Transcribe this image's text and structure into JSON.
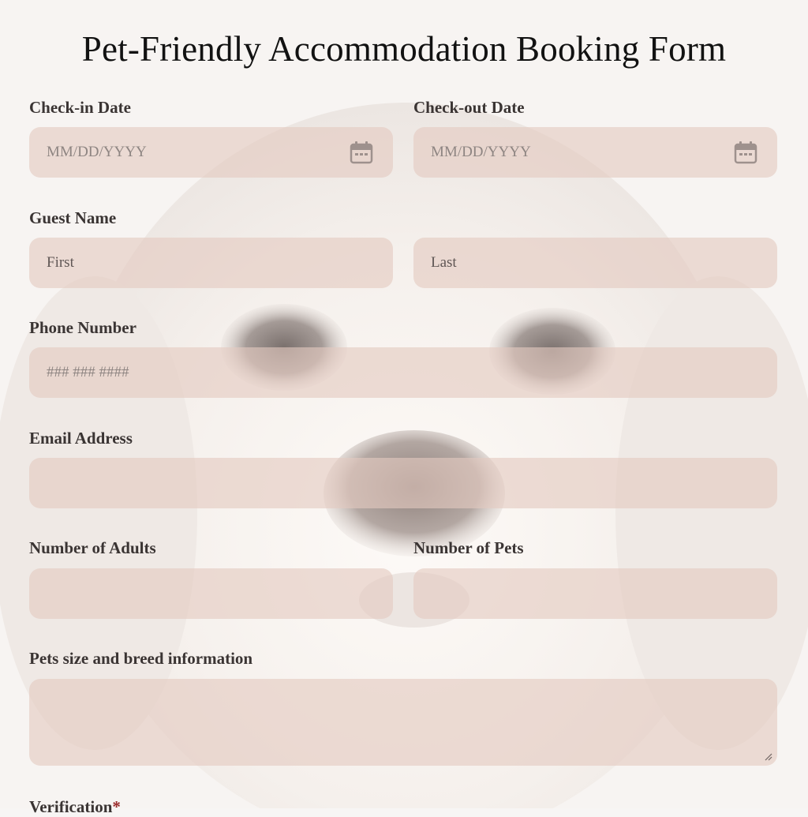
{
  "form": {
    "title": "Pet-Friendly Accommodation Booking Form"
  },
  "checkin": {
    "label": "Check-in Date",
    "placeholder": "MM/DD/YYYY",
    "icon": "calendar-icon"
  },
  "checkout": {
    "label": "Check-out Date",
    "placeholder": "MM/DD/YYYY",
    "icon": "calendar-icon"
  },
  "guest": {
    "label": "Guest Name",
    "first_placeholder": "First",
    "last_placeholder": "Last"
  },
  "phone": {
    "label": "Phone Number",
    "placeholder": "### ### ####"
  },
  "email": {
    "label": "Email Address",
    "value": ""
  },
  "adults": {
    "label": "Number of Adults",
    "value": ""
  },
  "pets": {
    "label": "Number of Pets",
    "value": ""
  },
  "pet_info": {
    "label": "Pets size and breed information",
    "value": ""
  },
  "verification": {
    "label": "Verification",
    "required_mark": "*"
  },
  "colors": {
    "field_bg": "#e3c9c0",
    "page_bg": "#f7f5f4",
    "required": "#9b2c2c"
  }
}
